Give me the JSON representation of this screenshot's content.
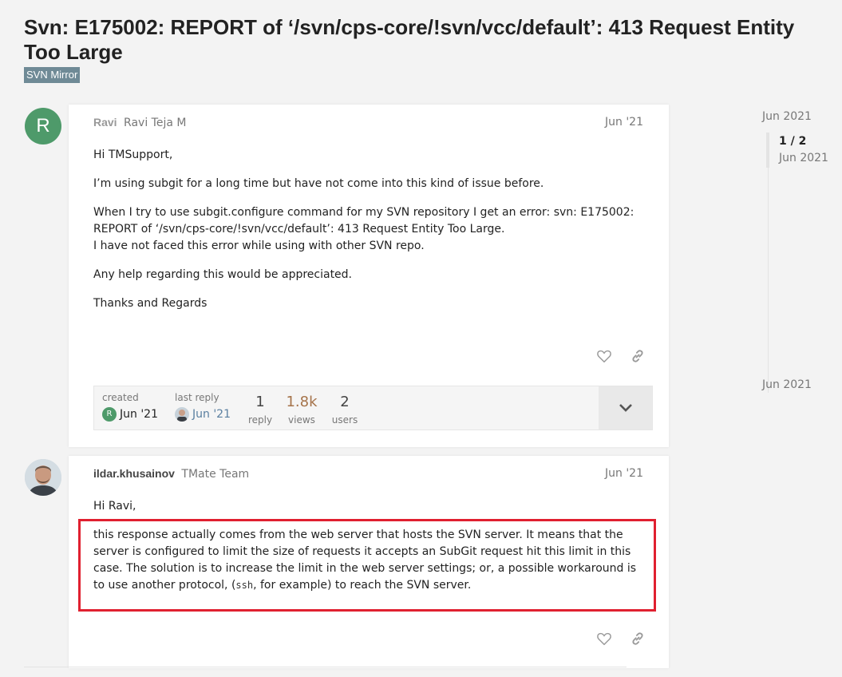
{
  "topic": {
    "title": "Svn: E175002: REPORT of ‘/svn/cps-core/!svn/vcc/default’: 413 Request Entity Too Large",
    "category": "SVN Mirror",
    "category_color": "#6f8a96"
  },
  "posts": [
    {
      "avatar_letter": "R",
      "avatar_color": "#4e9a6a",
      "username": "Ravi",
      "fullname": "Ravi Teja M",
      "date": "Jun '21",
      "paragraphs": [
        "Hi TMSupport,",
        "I’m using subgit for a long time but have not come into this kind of issue before.",
        "When I try to use subgit.configure command for my SVN repository I get an error: svn: E175002: REPORT of ‘/svn/cps-core/!svn/vcc/default’: 413 Request Entity Too Large.",
        "I have not faced this error while using with other SVN repo.",
        "Any help regarding this would be appreciated.",
        "Thanks and Regards"
      ],
      "icons": [
        "heart-icon",
        "link-icon"
      ]
    },
    {
      "avatar": "user-photo",
      "username": "ildar.khusainov",
      "fullname": "TMate Team",
      "date": "Jun '21",
      "greeting": "Hi Ravi,",
      "text_before_code": "this response actually comes from the web server that hosts the SVN server. It means that the server is configured to limit the size of requests it accepts an SubGit request hit this limit in this case. The solution is to increase the limit in the web server settings; or, a possible workaround is to use another protocol, (",
      "code": "ssh",
      "text_after_code": ", for example) to reach the SVN server.",
      "highlight_color": "#e02030",
      "icons": [
        "heart-icon",
        "link-icon"
      ]
    }
  ],
  "topic_map": {
    "created_label": "created",
    "created_avatar": "R",
    "created_date": "Jun '21",
    "last_reply_label": "last reply",
    "last_reply_date": "Jun '21",
    "replies_num": "1",
    "replies_label": "reply",
    "views_num": "1.8k",
    "views_label": "views",
    "users_num": "2",
    "users_label": "users"
  },
  "timeline": {
    "top_date": "Jun 2021",
    "position": "1 / 2",
    "current_date": "Jun 2021",
    "bottom_date": "Jun 2021"
  }
}
